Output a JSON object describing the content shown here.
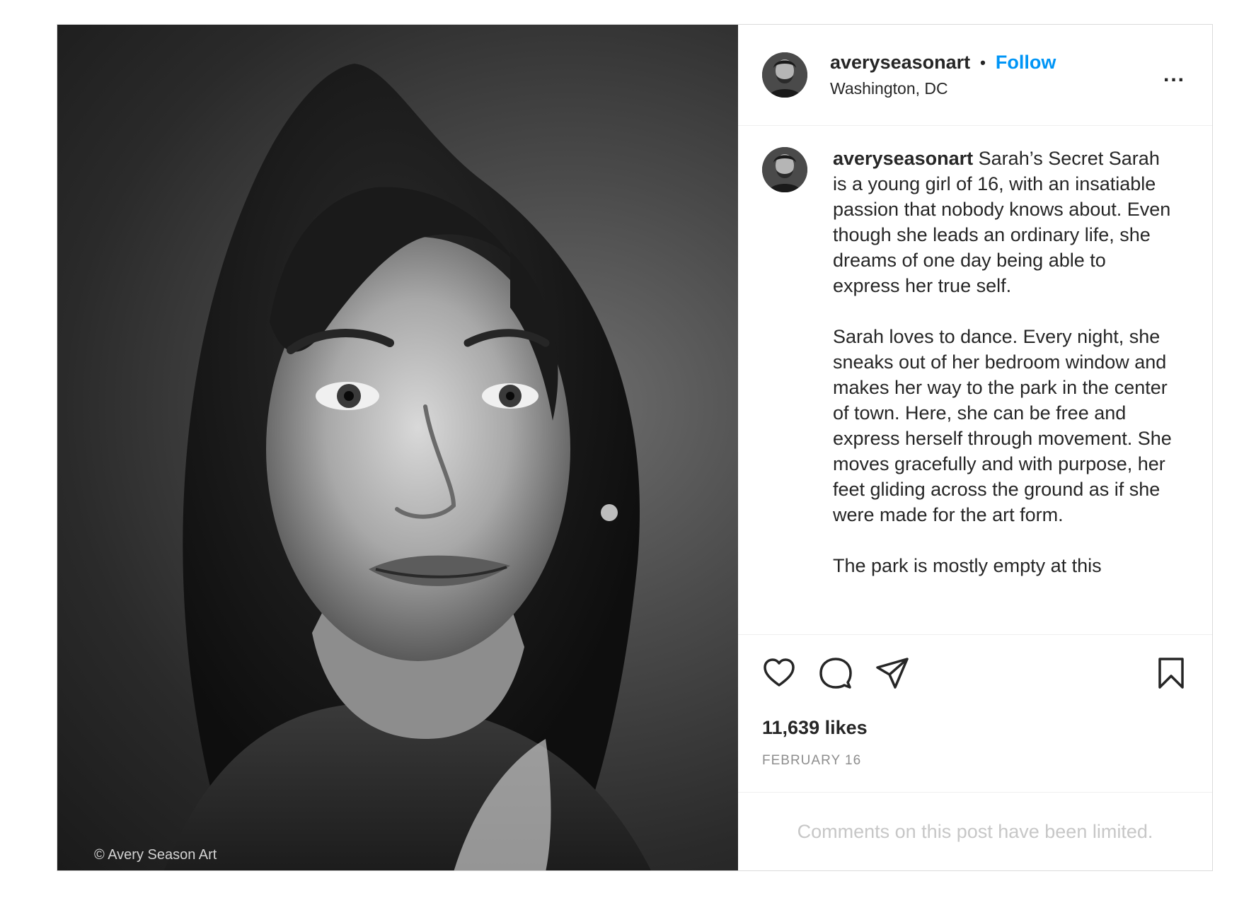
{
  "post": {
    "username": "averyseasonart",
    "separator": "•",
    "follow_label": "Follow",
    "location": "Washington, DC",
    "more_label": "...",
    "watermark": "© Avery Season Art",
    "caption": {
      "username": "averyseasonart",
      "title": "Sarah’s Secret",
      "paragraphs": [
        "Sarah is a young girl of 16, with an insatiable passion that nobody knows about. Even though she leads an ordinary life, she dreams of one day being able to express her true self.",
        "Sarah loves to dance. Every night, she sneaks out of her bedroom window and makes her way to the park in the center of town. Here, she can be free and express herself through movement. She moves gracefully and with purpose, her feet gliding across the ground as if she were made for the art form.",
        "The park is mostly empty at this"
      ]
    },
    "likes": "11,639 likes",
    "date": "FEBRUARY 16",
    "comments_limited": "Comments on this post have been limited."
  },
  "icons": {
    "like": "heart-icon",
    "comment": "comment-icon",
    "share": "share-icon",
    "save": "bookmark-icon",
    "more": "more-options-icon"
  },
  "colors": {
    "follow": "#0095f6",
    "muted": "#8e8e8e",
    "limited": "#c7c7c7"
  }
}
